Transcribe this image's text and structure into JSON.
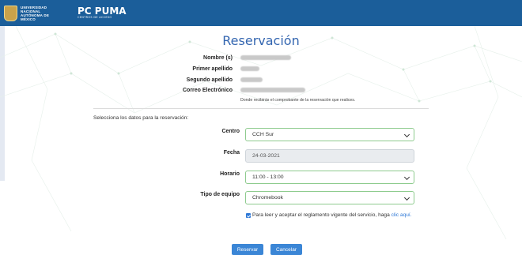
{
  "header": {
    "university_line1": "UNIVERSIDAD NACIONAL",
    "university_line2": "AUTÓNOMA DE MÉXICO",
    "brand": "PC PUMA",
    "brand_tagline": "CENTROS DE ACCESO"
  },
  "page": {
    "title": "Reservación"
  },
  "user_info": {
    "name_label": "Nombre (s)",
    "first_surname_label": "Primer apellido",
    "second_surname_label": "Segundo apellido",
    "email_label": "Correo Electrónico",
    "email_note": "Donde recibirás el comprobante de la reservación que realices."
  },
  "form": {
    "subheading": "Selecciona los datos para la reservación:",
    "centro_label": "Centro",
    "centro_value": "CCH Sur",
    "fecha_label": "Fecha",
    "fecha_value": "24-03-2021",
    "horario_label": "Horario",
    "horario_value": "11:00 - 13:00",
    "equipo_label": "Tipo de equipo",
    "equipo_value": "Chromebook",
    "terms_text": "Para leer y aceptar el reglamento vigente del servicio, haga ",
    "terms_link": "clic aquí.",
    "reservar_label": "Reservar",
    "cancelar_label": "Cancelar"
  },
  "colors": {
    "header_bg": "#1b5e9a",
    "title": "#3466b0",
    "button": "#3b86d6",
    "valid_border": "#8ecb8e"
  }
}
